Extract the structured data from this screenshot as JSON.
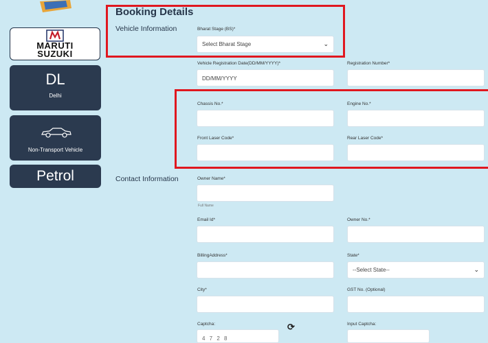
{
  "sidebar": {
    "brand": {
      "line1": "MARUTI",
      "line2": "SUZUKI"
    },
    "city": {
      "code": "DL",
      "name": "Delhi"
    },
    "vehicle_type": {
      "label": "Non-Transport Vehicle"
    },
    "fuel": {
      "label": "Petrol"
    }
  },
  "form": {
    "title": "Booking Details",
    "vehicle_section": "Vehicle Information",
    "contact_section": "Contact Information",
    "bharat_stage": {
      "label": "Bharat Stage (BS)*",
      "value": "Select Bharat Stage"
    },
    "reg_date": {
      "label": "Vehicle Registration Date(DD/MM/YYYY)*",
      "placeholder": "DD/MM/YYYY"
    },
    "reg_number": {
      "label": "Registration Number*"
    },
    "chassis": {
      "label": "Chassis No.*"
    },
    "engine": {
      "label": "Engine No.*"
    },
    "front_laser": {
      "label": "Front Laser Code*"
    },
    "rear_laser": {
      "label": "Rear Laser Code*"
    },
    "owner_name": {
      "label": "Owner Name*",
      "hint": "Full Name"
    },
    "email": {
      "label": "Email Id*"
    },
    "owner_no": {
      "label": "Owner No.*"
    },
    "billing": {
      "label": "BillingAddress*"
    },
    "state": {
      "label": "State*",
      "value": "--Select State--"
    },
    "city": {
      "label": "City*"
    },
    "gst": {
      "label": "GST No. (Optional)"
    },
    "captcha": {
      "label": "Captcha:",
      "value": "4 7 2 8"
    },
    "input_captcha": {
      "label": "Input Captcha:"
    }
  }
}
